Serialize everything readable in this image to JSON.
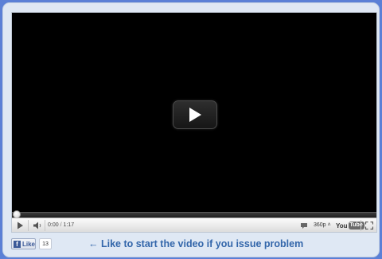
{
  "player": {
    "current_time": "0:00",
    "time_separator": " / ",
    "duration": "1:17",
    "quality": "360p",
    "quality_caret": "˄",
    "progress_fraction": 0,
    "logo": {
      "you": "You",
      "tube": "Tube"
    },
    "icons": {
      "center_play": "play-icon",
      "play": "play-icon",
      "volume": "volume-icon",
      "captions": "captions-icon",
      "fullscreen": "fullscreen-icon"
    }
  },
  "social": {
    "like_label": "Like",
    "like_count": "13"
  },
  "hint": {
    "text": "← Like to start the video if you issue problem"
  },
  "colors": {
    "page_background": "#5b80d6",
    "card_background": "#dfe8f4",
    "hint_text": "#3366aa",
    "facebook_blue": "#3b5998",
    "progress_red": "#cc0000"
  }
}
